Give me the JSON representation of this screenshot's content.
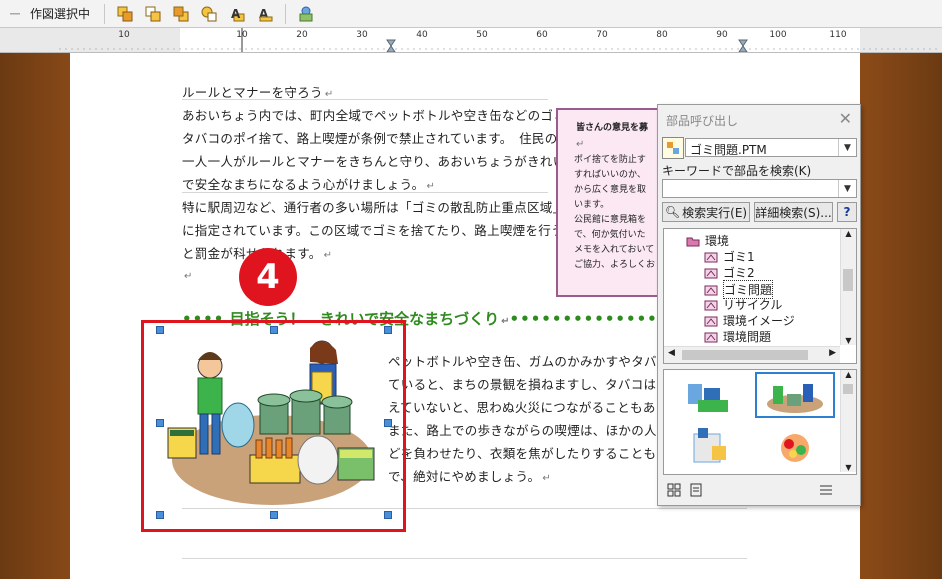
{
  "toolbar": {
    "mode_label": "作図選択中",
    "buttons": [
      "bring-front-icon",
      "bring-forward-icon",
      "send-back-icon",
      "send-backward-icon",
      "text-front-icon",
      "text-back-icon",
      "group-icon"
    ]
  },
  "ruler": {
    "labels": [
      "10",
      "10",
      "20",
      "30",
      "40",
      "50",
      "60",
      "70",
      "80",
      "90",
      "100",
      "110"
    ]
  },
  "document": {
    "title_line": "ルールとマナーを守ろう",
    "paragraph1": [
      "あおいちょう内では、町内全域でペットボトルや空き缶などのゴミ、",
      "タバコのポイ捨て、路上喫煙が条例で禁止されています。　住民の",
      "一人一人がルールとマナーをきちんと守り、あおいちょうがきれい",
      "で安全なまちになるよう心がけましょう。"
    ],
    "paragraph2": [
      "特に駅周辺など、通行者の多い場所は「ゴミの散乱防止重点区域」",
      "に指定されています。この区域でゴミを捨てたり、路上喫煙を行う",
      "と罰金が科せられます。"
    ],
    "heading": "目指そう！　きれいで安全なまちづくり",
    "body_lines": [
      "ペットボトルや空き缶、ガムのかみかすやタバコ",
      "ていると、まちの景観を損ねますし、タバコは",
      "えていないと、思わぬ火災につながることもあります",
      "また、路上での歩きながらの喫煙は、ほかの人に",
      "どを負わせたり、衣類を焦がしたりすることもあ",
      "で、絶対にやめましょう。"
    ],
    "opinion_box": {
      "title": "皆さんの意見を募",
      "lines": [
        "ポイ捨てを防止す",
        "すればいいのか、",
        "から広く意見を取",
        "います。",
        "公民館に意見箱を",
        "で、何か気付いた",
        "メモを入れておいて",
        "ご協力、よろしくお"
      ]
    }
  },
  "callout": {
    "step_number": "4",
    "color": "#e0141e"
  },
  "parts_panel": {
    "title": "部品呼び出し",
    "file_selected": "ゴミ問題.PTM",
    "keyword_label": "キーワードで部品を検索(K)",
    "keyword_value": "",
    "search_button": "検索実行(E)",
    "detail_button": "詳細検索(S)...",
    "help_button": "?",
    "tree": [
      {
        "label": "環境",
        "level": 0
      },
      {
        "label": "ゴミ1",
        "level": 1
      },
      {
        "label": "ゴミ2",
        "level": 1
      },
      {
        "label": "ゴミ問題",
        "level": 1,
        "selected": true
      },
      {
        "label": "リサイクル",
        "level": 1
      },
      {
        "label": "環境イメージ",
        "level": 1
      },
      {
        "label": "環境問題",
        "level": 1
      }
    ]
  }
}
